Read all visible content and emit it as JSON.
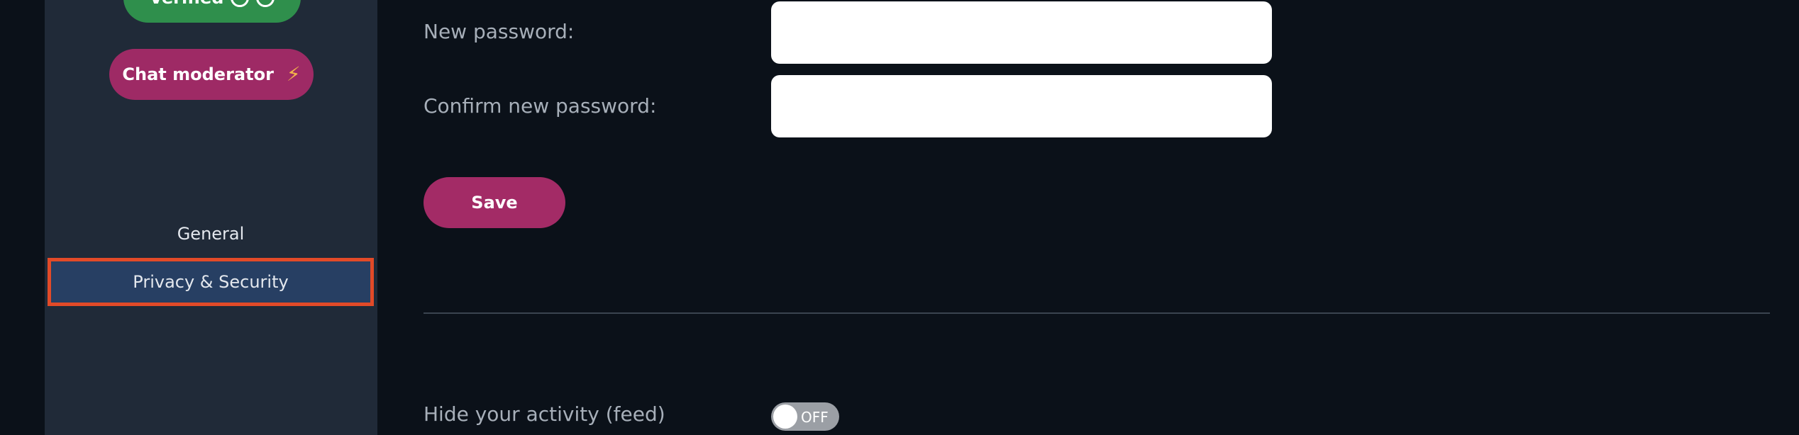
{
  "sidebar": {
    "badges": {
      "verified_label": "Verified",
      "moderator_label": "Chat moderator",
      "moderator_icon": "lightning-bolt-icon"
    },
    "nav": {
      "general": "General",
      "privacy": "Privacy & Security",
      "selected": "privacy"
    }
  },
  "password_form": {
    "new_password_label": "New password:",
    "new_password_value": "",
    "confirm_password_label": "Confirm new password:",
    "confirm_password_value": "",
    "save_label": "Save"
  },
  "activity": {
    "hide_activity_label": "Hide your activity (feed)",
    "toggle_state": "OFF"
  },
  "colors": {
    "background": "#0b1119",
    "sidebar": "#202a38",
    "accent": "#a32b66",
    "verified": "#2f8f4c",
    "selected_nav": "#273f63",
    "highlight_border": "#e24a28"
  }
}
